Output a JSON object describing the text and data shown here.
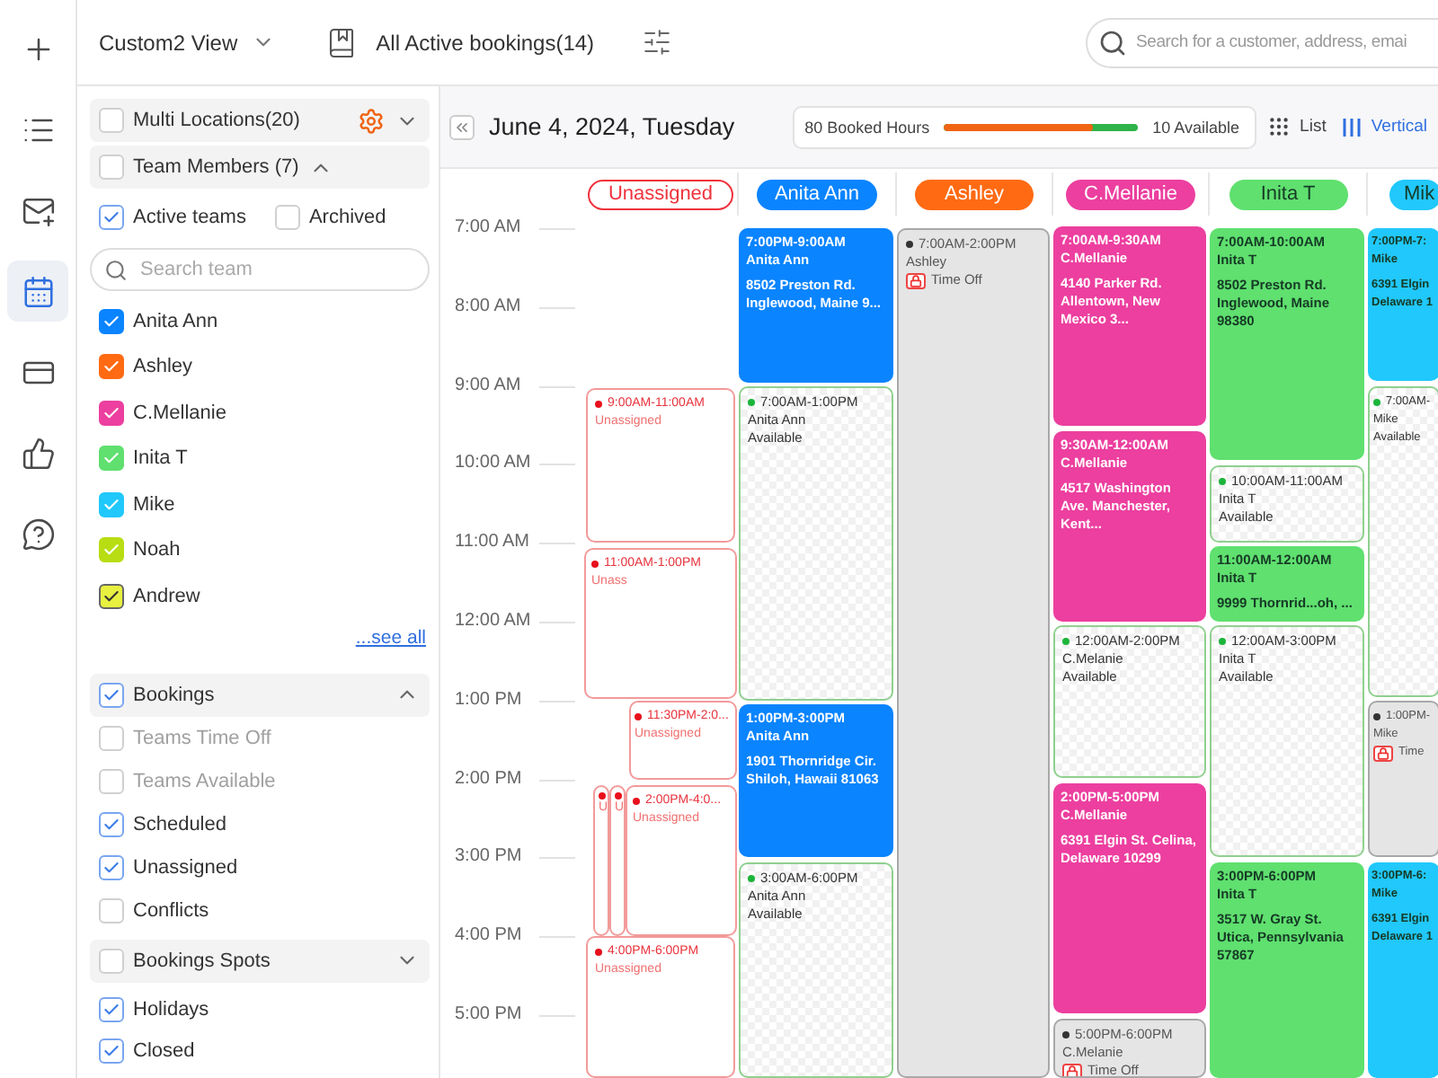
{
  "rail": [
    {
      "selected": false
    },
    {
      "selected": false
    },
    {
      "selected": false
    },
    {
      "selected": true
    },
    {
      "selected": false
    },
    {
      "selected": false
    },
    {
      "selected": false
    }
  ],
  "toolbar": {
    "view": "Custom2 View",
    "bookings": "All Active bookings(14)",
    "search": {
      "placeholder": "Search for a customer, address, emai"
    }
  },
  "locations": {
    "label": "Multi Locations(20)",
    "checked": false,
    "expanded": false
  },
  "team": {
    "label": "Team Members (7)",
    "checked": false,
    "expanded": true,
    "filters": [
      {
        "label": "Active teams",
        "checked": true
      },
      {
        "label": "Archived",
        "checked": false
      }
    ],
    "search": {
      "placeholder": "Search team"
    },
    "members": [
      {
        "name": "Anita Ann",
        "checked": true,
        "color": "#0a84ff"
      },
      {
        "name": "Ashley",
        "checked": true,
        "color": "#ff6a13"
      },
      {
        "name": "C.Mellanie",
        "checked": true,
        "color": "#ec3f9f"
      },
      {
        "name": "Inita T",
        "checked": true,
        "color": "#5fe06f"
      },
      {
        "name": "Mike",
        "checked": true,
        "color": "#21c8fb"
      },
      {
        "name": "Noah",
        "checked": true,
        "color": "#b8dd12"
      },
      {
        "name": "Andrew",
        "checked": true,
        "color": "#e8f040"
      }
    ],
    "see_all": "...see all"
  },
  "bookings": {
    "label": "Bookings",
    "checked": true,
    "expanded": true,
    "items": [
      {
        "label": "Teams Time Off",
        "checked": false,
        "disabled": true
      },
      {
        "label": "Teams Available",
        "checked": false,
        "disabled": true
      },
      {
        "label": "Scheduled",
        "checked": true,
        "disabled": false
      },
      {
        "label": "Unassigned",
        "checked": true,
        "disabled": false
      },
      {
        "label": "Conflicts",
        "checked": false,
        "disabled": false
      }
    ]
  },
  "spots": {
    "label": "Bookings Spots",
    "checked": false,
    "expanded": false
  },
  "more_filters": [
    {
      "label": "Holidays",
      "checked": true
    },
    {
      "label": "Closed",
      "checked": true
    }
  ],
  "date": "June 4, 2024, Tuesday",
  "summary": {
    "booked": "80 Booked Hours",
    "level": 0.77,
    "available": "10 Available"
  },
  "view_modes": [
    {
      "label": "List",
      "selected": false
    },
    {
      "label": "Vertical",
      "selected": true
    }
  ],
  "hours": [
    "7:00 AM",
    "8:00 AM",
    "9:00 AM",
    "10:00 AM",
    "11:00 AM",
    "12:00 AM",
    "1:00 PM",
    "2:00 PM",
    "3:00 PM",
    "4:00 PM",
    "5:00 PM"
  ],
  "columns": [
    {
      "name": "Unassigned",
      "kind": "unassigned",
      "color": "#f0323c",
      "events": [
        {
          "kind": "unassigned",
          "time": "9:00AM-11:00AM",
          "name": "Unassigned"
        },
        {
          "kind": "unassigned",
          "time": "11:00AM-1:00PM",
          "name": "Unass"
        },
        {
          "kind": "unassigned",
          "time": "11:30PM-2:0...",
          "name": "Unassigned"
        },
        {
          "kind": "unassigned",
          "name": "U"
        },
        {
          "kind": "unassigned",
          "name": "U"
        },
        {
          "kind": "unassigned",
          "time": "2:00PM-4:0...",
          "name": "Unassigned"
        },
        {
          "kind": "unassigned",
          "time": "4:00PM-6:00PM",
          "name": "Unassigned"
        }
      ]
    },
    {
      "name": "Anita Ann",
      "kind": "member",
      "color": "#0a84ff",
      "events": [
        {
          "kind": "booked",
          "time": "7:00PM-9:00AM",
          "name": "Anita Ann",
          "address": [
            "8502 Preston Rd.",
            "Inglewood, Maine 9..."
          ]
        },
        {
          "kind": "available",
          "time": "7:00AM-1:00PM",
          "name": "Anita Ann",
          "status": "Available"
        },
        {
          "kind": "booked",
          "time": "1:00PM-3:00PM",
          "name": "Anita Ann",
          "address": [
            "1901 Thornridge Cir.",
            "Shiloh, Hawaii 81063"
          ]
        },
        {
          "kind": "available",
          "time": "3:00AM-6:00PM",
          "name": "Anita Ann",
          "status": "Available"
        }
      ]
    },
    {
      "name": "Ashley",
      "kind": "member",
      "color": "#ff6a13",
      "events": [
        {
          "kind": "time_off",
          "time": "7:00AM-2:00PM",
          "name": "Ashley",
          "status": "Time Off"
        }
      ]
    },
    {
      "name": "C.Mellanie",
      "kind": "member",
      "color": "#ec3f9f",
      "events": [
        {
          "kind": "booked",
          "time": "7:00AM-9:30AM",
          "name": "C.Mellanie",
          "address": [
            "4140 Parker Rd.",
            "Allentown, New",
            "Mexico 3..."
          ]
        },
        {
          "kind": "booked",
          "time": "9:30AM-12:00AM",
          "name": "C.Mellanie",
          "address": [
            "4517 Washington",
            "Ave. Manchester,",
            "Kent..."
          ]
        },
        {
          "kind": "available",
          "time": "12:00AM-2:00PM",
          "name": "C.Melanie",
          "status": "Available"
        },
        {
          "kind": "booked",
          "time": "2:00PM-5:00PM",
          "name": "C.Mellanie",
          "address": [
            "6391 Elgin St. Celina,",
            "Delaware 10299"
          ]
        },
        {
          "kind": "time_off",
          "time": "5:00PM-6:00PM",
          "name": "C.Melanie",
          "status": "Time Off"
        }
      ]
    },
    {
      "name": "Inita T",
      "kind": "member",
      "color": "#5fe06f",
      "events": [
        {
          "kind": "booked",
          "time": "7:00AM-10:00AM",
          "name": "Inita T",
          "address": [
            "8502 Preston Rd.",
            "Inglewood, Maine",
            "98380"
          ]
        },
        {
          "kind": "available",
          "time": "10:00AM-11:00AM",
          "name": "Inita T",
          "status": "Available"
        },
        {
          "kind": "booked",
          "time": "11:00AM-12:00AM",
          "name": "Inita T",
          "address": [
            "9999 Thornrid...oh, ..."
          ]
        },
        {
          "kind": "available",
          "time": "12:00AM-3:00PM",
          "name": "Inita T",
          "status": "Available"
        },
        {
          "kind": "booked",
          "time": "3:00PM-6:00PM",
          "name": "Inita T",
          "address": [
            "3517 W. Gray St.",
            "Utica, Pennsylvania",
            "57867"
          ]
        }
      ]
    },
    {
      "name": "Mik",
      "kind": "member",
      "color": "#21c8fb",
      "events": [
        {
          "kind": "booked",
          "time": "7:00PM-7:",
          "name": "Mike",
          "address": [
            "6391 Elgin",
            "Delaware 1"
          ]
        },
        {
          "kind": "available",
          "time": "7:00AM-",
          "name": "Mike",
          "status": "Available"
        },
        {
          "kind": "time_off",
          "time": "1:00PM-",
          "name": "Mike",
          "status": "Time"
        },
        {
          "kind": "booked",
          "time": "3:00PM-6:",
          "name": "Mike",
          "address": [
            "6391 Elgin",
            "Delaware 1"
          ]
        }
      ]
    }
  ]
}
